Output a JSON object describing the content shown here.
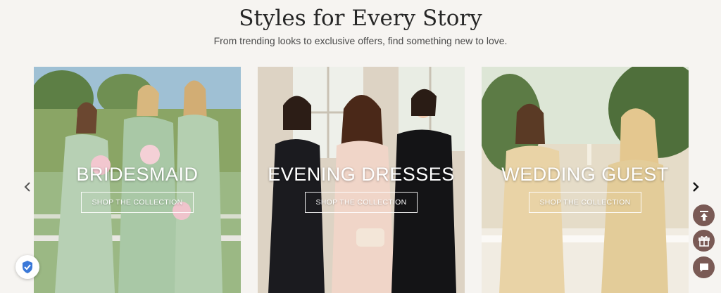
{
  "section": {
    "title": "Styles for Every Story",
    "subtitle": "From trending looks to exclusive offers, find something new to love."
  },
  "cards": [
    {
      "title": "BRIDESMAID",
      "cta": "SHOP THE COLLECTION",
      "image": "bridesmaids-in-sage-green-dresses-photo"
    },
    {
      "title": "EVENING DRESSES",
      "cta": "SHOP THE COLLECTION",
      "image": "women-in-evening-gowns-photo"
    },
    {
      "title": "WEDDING GUEST",
      "cta": "SHOP THE COLLECTION",
      "image": "wedding-guests-in-champagne-dresses-photo"
    }
  ],
  "carousel": {
    "prev_icon": "chevron-left-icon",
    "next_icon": "chevron-right-icon"
  },
  "floating_actions": [
    {
      "icon": "back-to-top-icon"
    },
    {
      "icon": "gift-icon"
    },
    {
      "icon": "chat-icon"
    }
  ],
  "badge": {
    "icon": "shield-badge-icon"
  },
  "colors": {
    "background": "#f6f4f1",
    "action_button": "#7a5a55",
    "text_dark": "#262626"
  }
}
